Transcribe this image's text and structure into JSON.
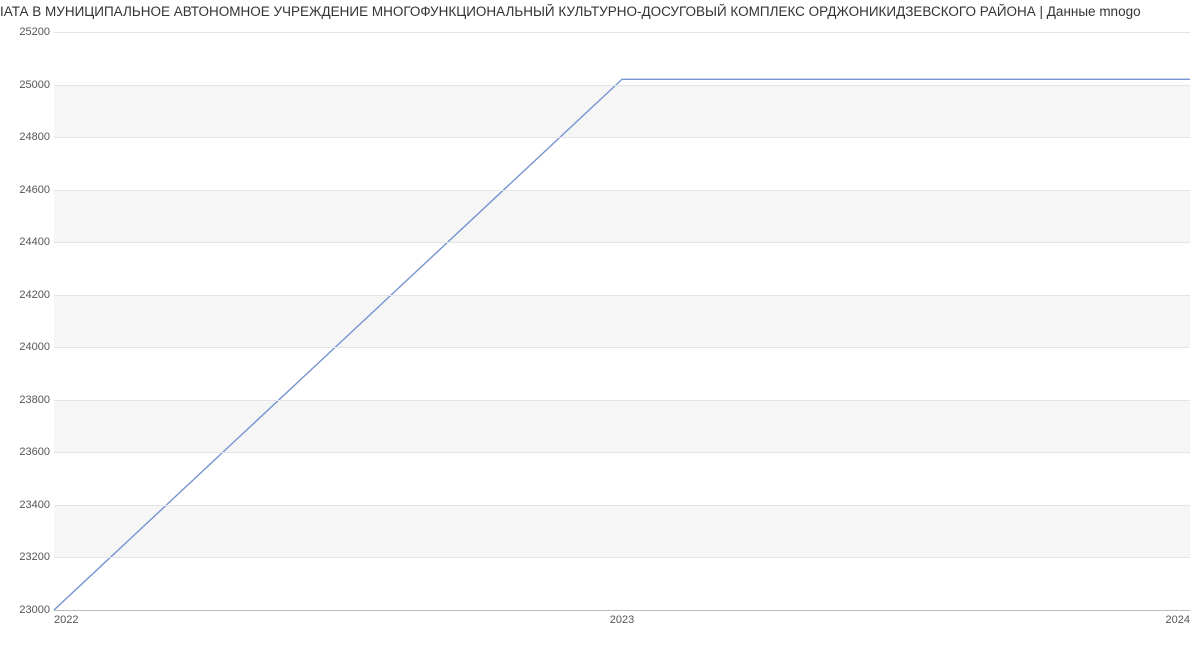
{
  "title": "ІАТА В МУНИЦИПАЛЬНОЕ АВТОНОМНОЕ УЧРЕЖДЕНИЕ МНОГОФУНКЦИОНАЛЬНЫЙ КУЛЬТУРНО-ДОСУГОВЫЙ КОМПЛЕКС ОРДЖОНИКИДЗЕВСКОГО РАЙОНА | Данные mnogo",
  "chart_data": {
    "type": "line",
    "title": "ІАТА В МУНИЦИПАЛЬНОЕ АВТОНОМНОЕ УЧРЕЖДЕНИЕ МНОГОФУНКЦИОНАЛЬНЫЙ КУЛЬТУРНО-ДОСУГОВЫЙ КОМПЛЕКС ОРДЖОНИКИДЗЕВСКОГО РАЙОНА | Данные mnogo",
    "xlabel": "",
    "ylabel": "",
    "x": [
      2022,
      2023,
      2024
    ],
    "y": [
      23000,
      25020,
      25020
    ],
    "series_name": "",
    "ylim": [
      23000,
      25200
    ],
    "yticks": [
      23000,
      23200,
      23400,
      23600,
      23800,
      24000,
      24200,
      24400,
      24600,
      24800,
      25000,
      25200
    ],
    "xticks": [
      2022,
      2023,
      2024
    ],
    "grid": true,
    "colors": {
      "line": "#7694d0",
      "band": "#f6f6f7",
      "grid": "#e4e4e8"
    }
  }
}
